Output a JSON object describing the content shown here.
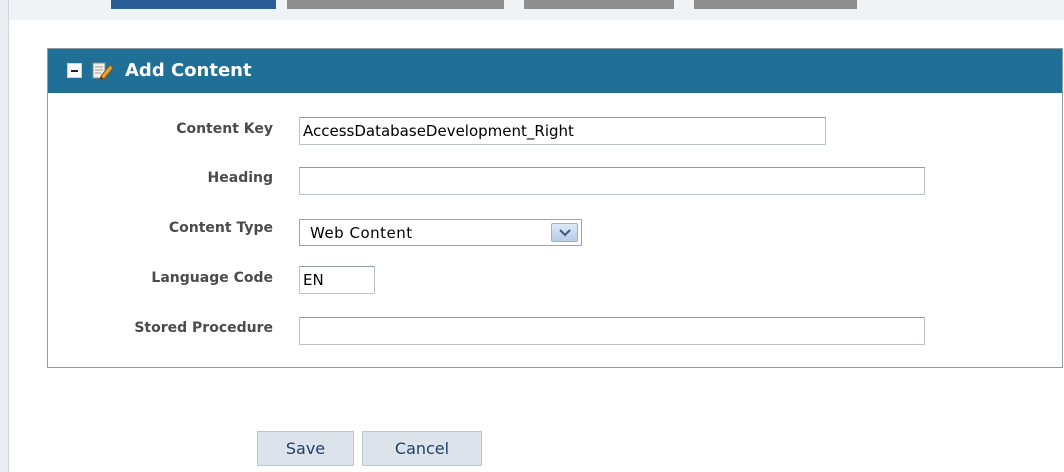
{
  "form": {
    "title": "Add Content",
    "collapse_icon": "minus-square-icon",
    "edit_icon": "pencil-edit-icon",
    "fields": {
      "content_key": {
        "label": "Content Key",
        "value": "AccessDatabaseDevelopment_Right"
      },
      "heading": {
        "label": "Heading",
        "value": ""
      },
      "content_type": {
        "label": "Content Type",
        "value": "Web Content"
      },
      "language_code": {
        "label": "Language Code",
        "value": "EN"
      },
      "stored_procedure": {
        "label": "Stored Procedure",
        "value": ""
      }
    }
  },
  "buttons": {
    "save": "Save",
    "cancel": "Cancel"
  },
  "colors": {
    "header_bg": "#1f6f97",
    "active_tab": "#2a5e97",
    "inactive_tab": "#8e8e8e",
    "button_text": "#1f3f6a"
  }
}
